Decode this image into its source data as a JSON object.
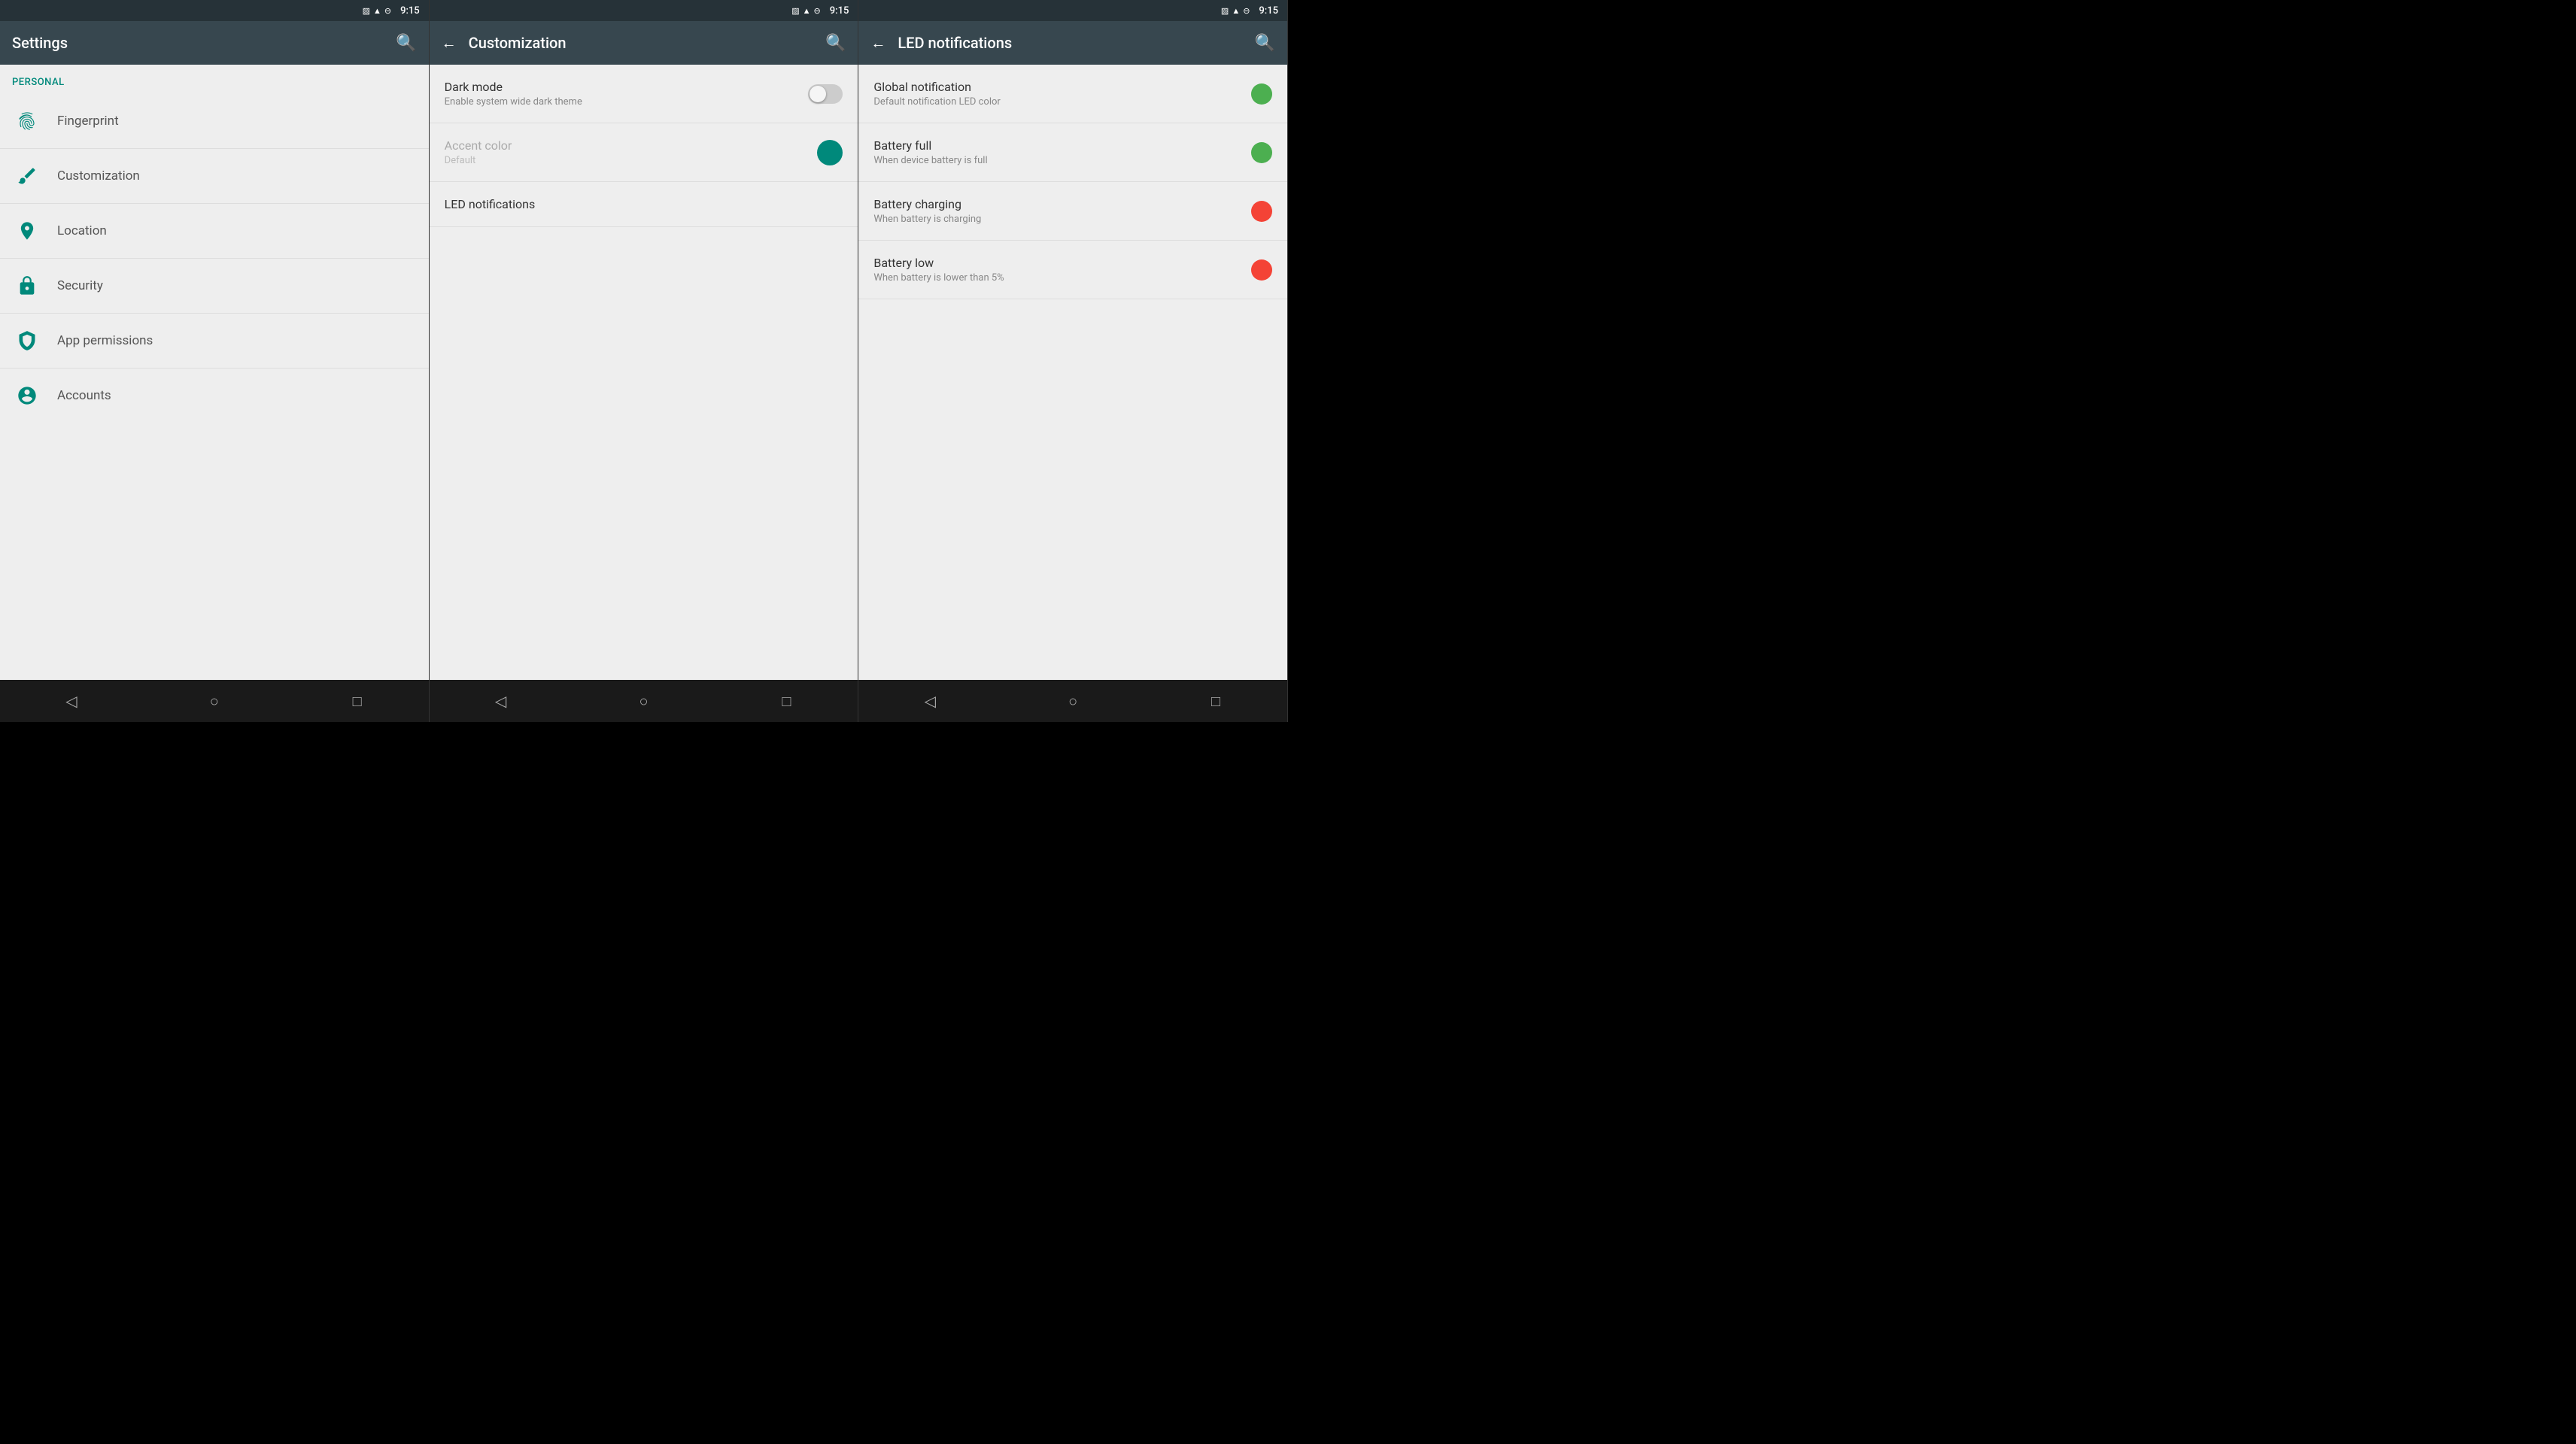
{
  "panels": [
    {
      "id": "settings",
      "statusBar": {
        "time": "9:15",
        "icons": [
          "vibrate",
          "signal",
          "battery"
        ]
      },
      "appBar": {
        "title": "Settings",
        "hasBack": false,
        "hasSearch": true
      },
      "sectionHeader": "Personal",
      "items": [
        {
          "id": "fingerprint",
          "label": "Fingerprint",
          "icon": "fingerprint"
        },
        {
          "id": "customization",
          "label": "Customization",
          "icon": "paint"
        },
        {
          "id": "location",
          "label": "Location",
          "icon": "location"
        },
        {
          "id": "security",
          "label": "Security",
          "icon": "security"
        },
        {
          "id": "app-permissions",
          "label": "App permissions",
          "icon": "shield"
        },
        {
          "id": "accounts",
          "label": "Accounts",
          "icon": "account"
        }
      ],
      "navBar": {
        "back": "◁",
        "home": "○",
        "recents": "□"
      }
    },
    {
      "id": "customization",
      "statusBar": {
        "time": "9:15",
        "icons": [
          "vibrate",
          "signal",
          "battery"
        ]
      },
      "appBar": {
        "title": "Customization",
        "hasBack": true,
        "hasSearch": true
      },
      "items": [
        {
          "id": "dark-mode",
          "title": "Dark mode",
          "subtitle": "Enable system wide dark theme",
          "type": "toggle",
          "toggleOn": false,
          "disabled": false
        },
        {
          "id": "accent-color",
          "title": "Accent color",
          "subtitle": "Default",
          "type": "color",
          "color": "#00897b",
          "disabled": true
        },
        {
          "id": "led-notifications",
          "title": "LED notifications",
          "subtitle": null,
          "type": "link",
          "disabled": false
        }
      ],
      "navBar": {
        "back": "◁",
        "home": "○",
        "recents": "□"
      }
    },
    {
      "id": "led-notifications",
      "statusBar": {
        "time": "9:15",
        "icons": [
          "vibrate",
          "signal",
          "battery"
        ]
      },
      "appBar": {
        "title": "LED notifications",
        "hasBack": true,
        "hasSearch": true
      },
      "items": [
        {
          "id": "global-notification",
          "title": "Global notification",
          "subtitle": "Default notification LED color",
          "color": "#4caf50",
          "dotColor": "#4caf50"
        },
        {
          "id": "battery-full",
          "title": "Battery full",
          "subtitle": "When device battery is full",
          "color": "#4caf50",
          "dotColor": "#4caf50"
        },
        {
          "id": "battery-charging",
          "title": "Battery charging",
          "subtitle": "When battery is charging",
          "color": "#f44336",
          "dotColor": "#f44336"
        },
        {
          "id": "battery-low",
          "title": "Battery low",
          "subtitle": "When battery is lower than 5%",
          "color": "#f44336",
          "dotColor": "#f44336"
        }
      ],
      "navBar": {
        "back": "◁",
        "home": "○",
        "recents": "□"
      }
    }
  ]
}
